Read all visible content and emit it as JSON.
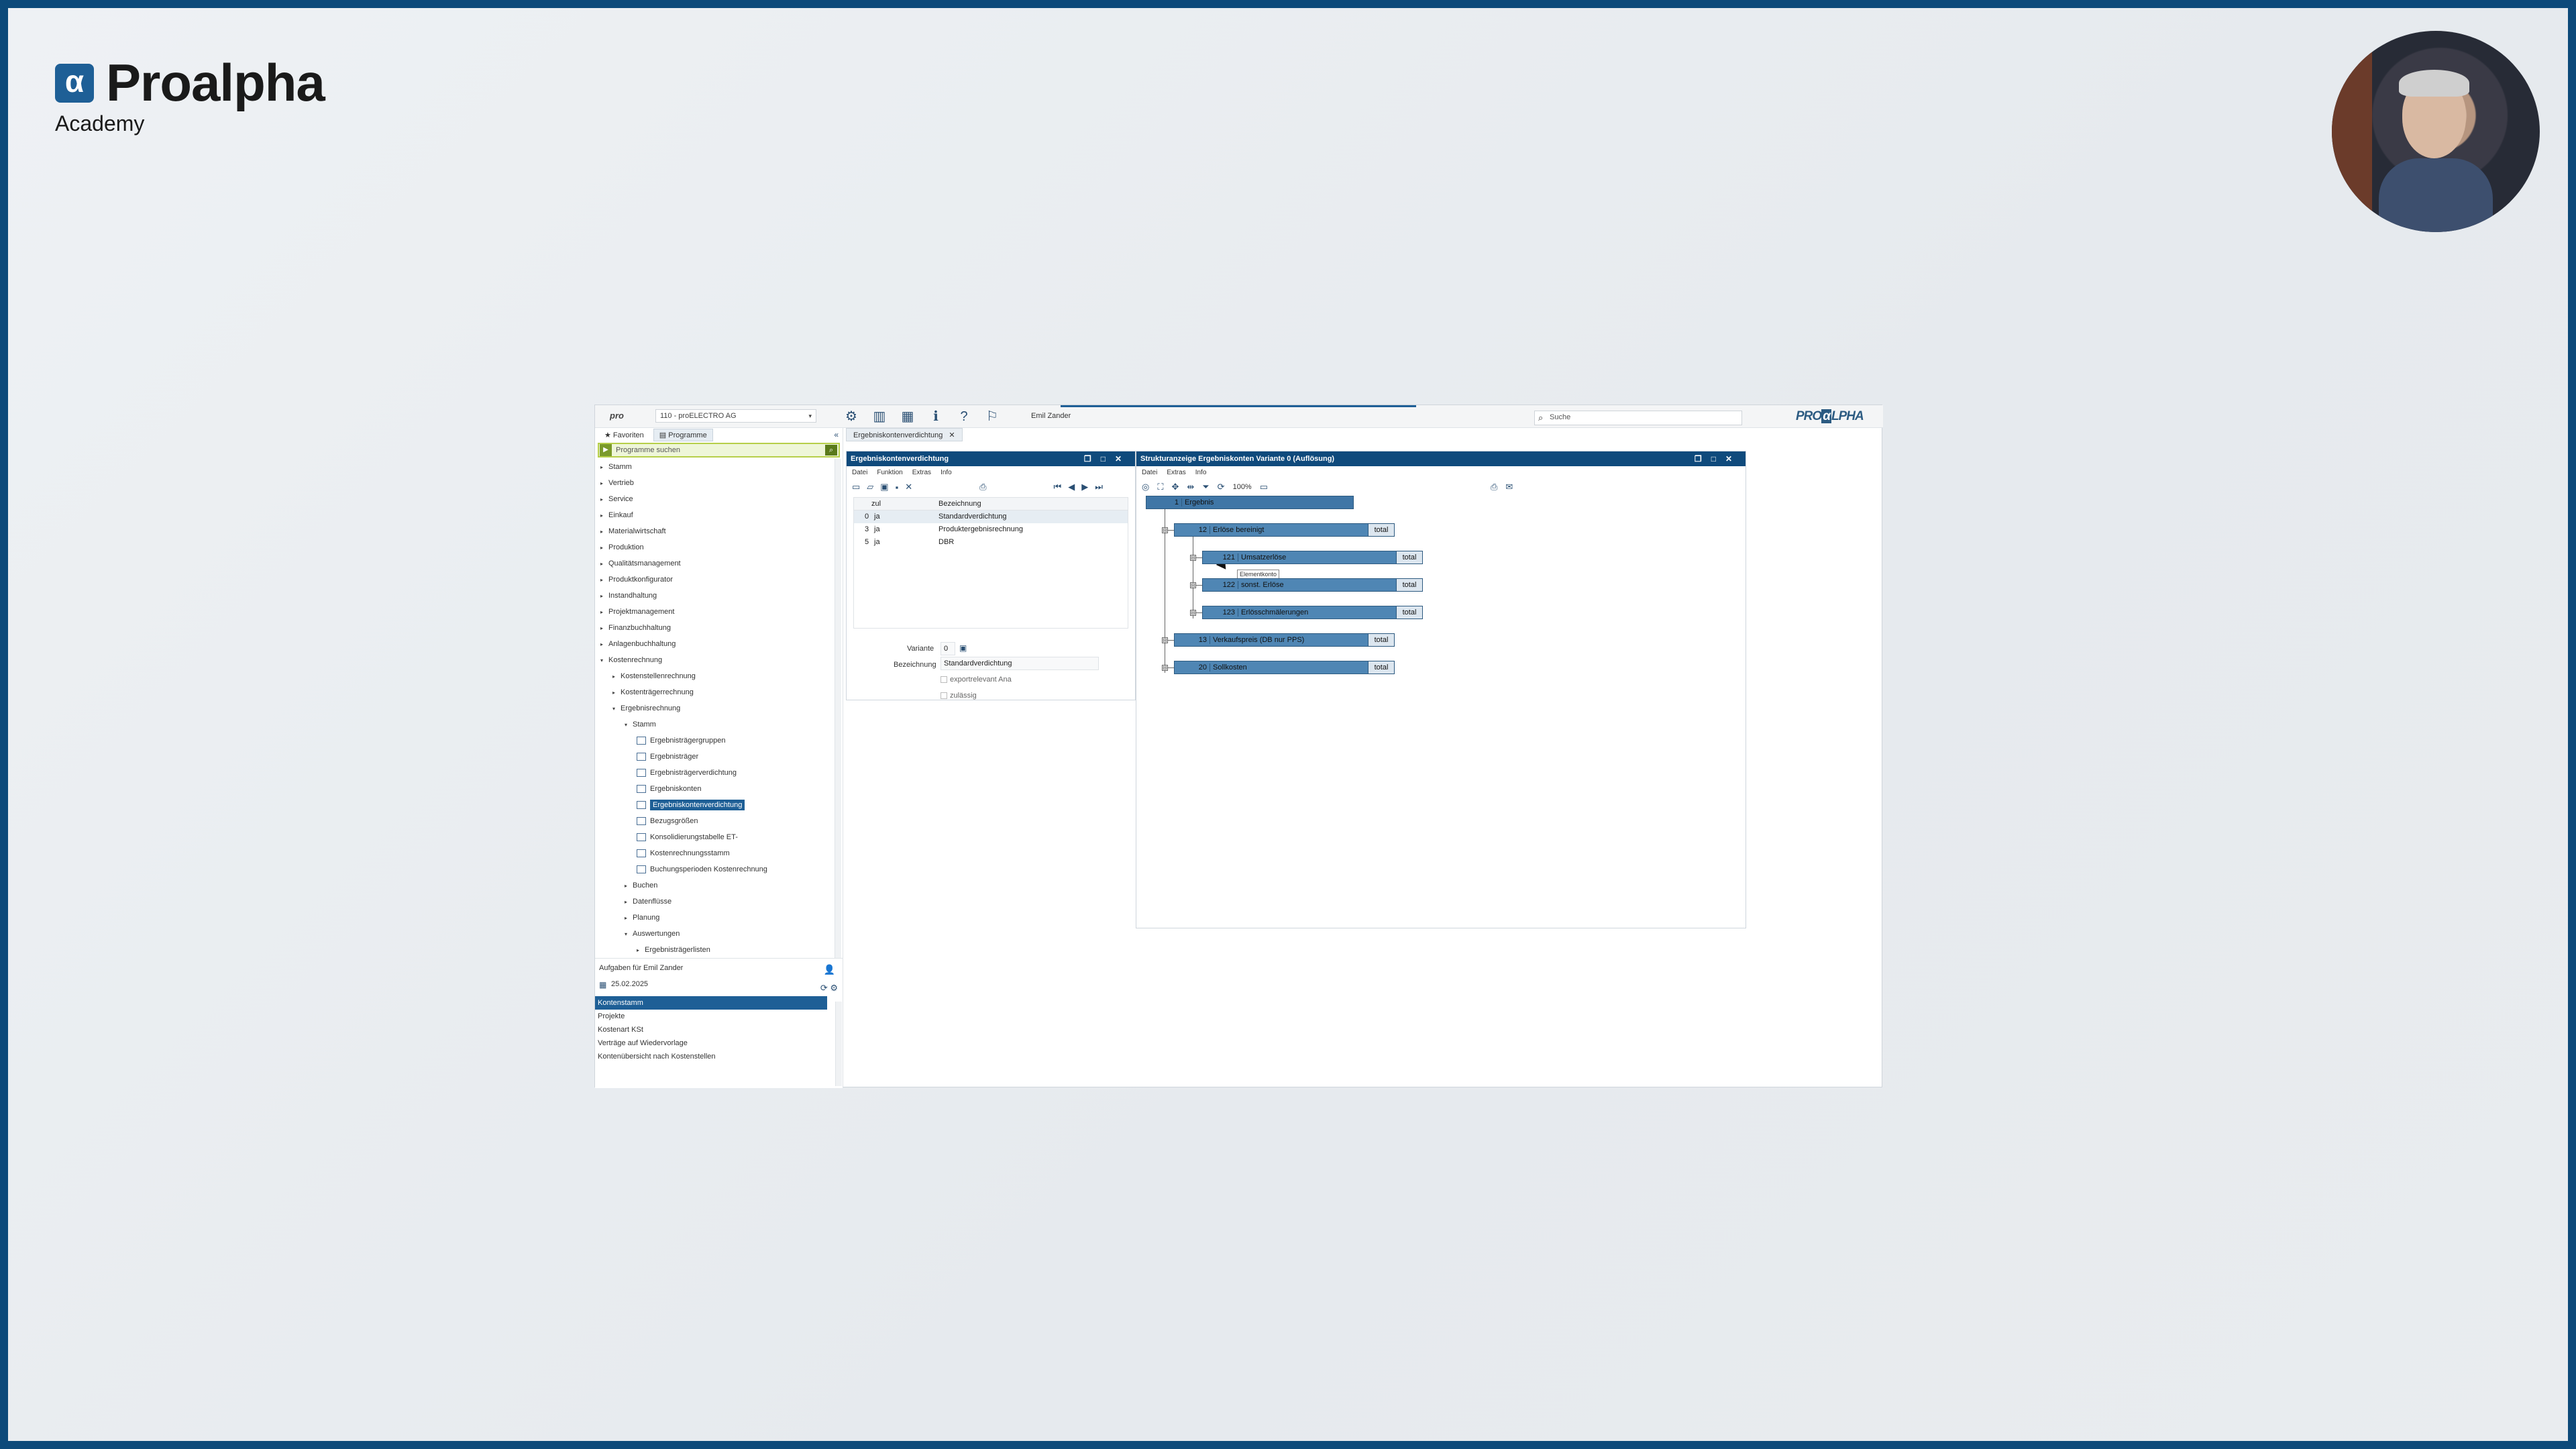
{
  "branding": {
    "logo_mark": "α",
    "logo_text": "Proalpha",
    "academy": "Academy"
  },
  "topbar": {
    "pro_logo": "pro",
    "company": "110 - proELECTRO AG",
    "user": "Emil Zander",
    "search_placeholder": "Suche",
    "brand_pre": "PRO",
    "brand_box": "α",
    "brand_post": "LPHA"
  },
  "left_panel": {
    "tabs": [
      "Favoriten",
      "Programme"
    ],
    "program_search_placeholder": "Programme suchen",
    "tree": [
      {
        "label": "Stamm",
        "level": 0,
        "arrow": "▸"
      },
      {
        "label": "Vertrieb",
        "level": 0,
        "arrow": "▸"
      },
      {
        "label": "Service",
        "level": 0,
        "arrow": "▸"
      },
      {
        "label": "Einkauf",
        "level": 0,
        "arrow": "▸"
      },
      {
        "label": "Materialwirtschaft",
        "level": 0,
        "arrow": "▸"
      },
      {
        "label": "Produktion",
        "level": 0,
        "arrow": "▸"
      },
      {
        "label": "Qualitätsmanagement",
        "level": 0,
        "arrow": "▸"
      },
      {
        "label": "Produktkonfigurator",
        "level": 0,
        "arrow": "▸"
      },
      {
        "label": "Instandhaltung",
        "level": 0,
        "arrow": "▸"
      },
      {
        "label": "Projektmanagement",
        "level": 0,
        "arrow": "▸"
      },
      {
        "label": "Finanzbuchhaltung",
        "level": 0,
        "arrow": "▸"
      },
      {
        "label": "Anlagenbuchhaltung",
        "level": 0,
        "arrow": "▸"
      },
      {
        "label": "Kostenrechnung",
        "level": 0,
        "arrow": "▾"
      },
      {
        "label": "Kostenstellenrechnung",
        "level": 1,
        "arrow": "▸"
      },
      {
        "label": "Kostenträgerrechnung",
        "level": 1,
        "arrow": "▸"
      },
      {
        "label": "Ergebnisrechnung",
        "level": 1,
        "arrow": "▾"
      },
      {
        "label": "Stamm",
        "level": 2,
        "arrow": "▾"
      },
      {
        "label": "Ergebnisträgergruppen",
        "level": 3,
        "doc": true
      },
      {
        "label": "Ergebnisträger",
        "level": 3,
        "doc": true
      },
      {
        "label": "Ergebnisträgerverdichtung",
        "level": 3,
        "doc": true
      },
      {
        "label": "Ergebniskonten",
        "level": 3,
        "doc": true
      },
      {
        "label": "Ergebniskontenverdichtung",
        "level": 3,
        "doc": true,
        "selected": true
      },
      {
        "label": "Bezugsgrößen",
        "level": 3,
        "doc": true
      },
      {
        "label": "Konsolidierungstabelle ET-",
        "level": 3,
        "doc": true
      },
      {
        "label": "Kostenrechnungsstamm",
        "level": 3,
        "doc": true
      },
      {
        "label": "Buchungsperioden Kostenrechnung",
        "level": 3,
        "doc": true
      },
      {
        "label": "Buchen",
        "level": 2,
        "arrow": "▸"
      },
      {
        "label": "Datenflüsse",
        "level": 2,
        "arrow": "▸"
      },
      {
        "label": "Planung",
        "level": 2,
        "arrow": "▸"
      },
      {
        "label": "Auswertungen",
        "level": 2,
        "arrow": "▾"
      },
      {
        "label": "Ergebnisträgerlisten",
        "level": 3,
        "arrow": "▸"
      }
    ],
    "tasks": {
      "title": "Aufgaben für Emil Zander",
      "date": "25.02.2025",
      "items": [
        "Kontenstamm",
        "Projekte",
        "Kostenart KSt",
        "Verträge auf Wiedervorlage",
        "Kontenübersicht nach Kostenstellen"
      ]
    }
  },
  "doc_tab": {
    "label": "Ergebniskontenverdichtung"
  },
  "window1": {
    "title": "Ergebniskontenverdichtung",
    "menu": [
      "Datei",
      "Funktion",
      "Extras",
      "Info"
    ],
    "grid": {
      "headers": [
        "",
        "zul",
        "Bezeichnung"
      ],
      "rows": [
        {
          "nr": "0",
          "zul": "ja",
          "label": "Standardverdichtung",
          "selected": true
        },
        {
          "nr": "3",
          "zul": "ja",
          "label": "Produktergebnisrechnung"
        },
        {
          "nr": "5",
          "zul": "ja",
          "label": "DBR"
        }
      ]
    },
    "form": {
      "variante_label": "Variante",
      "variante_value": "0",
      "bezeichnung_label": "Bezeichnung",
      "bezeichnung_value": "Standardverdichtung",
      "check1": "exportrelevant Ana",
      "check2": "zulässig"
    }
  },
  "window2": {
    "title": "Strukturanzeige Ergebniskonten Variante 0 (Auflösung)",
    "menu": [
      "Datei",
      "Extras",
      "Info"
    ],
    "zoom": "100%",
    "tooltip": "Elementkonto",
    "nodes": [
      {
        "num": "1",
        "label": "Ergebnis",
        "total": ""
      },
      {
        "num": "12",
        "label": "Erlöse bereinigt",
        "total": "total"
      },
      {
        "num": "121",
        "label": "Umsatzerlöse",
        "total": "total"
      },
      {
        "num": "122",
        "label": "sonst. Erlöse",
        "total": "total"
      },
      {
        "num": "123",
        "label": "Erlösschmälerungen",
        "total": "total"
      },
      {
        "num": "13",
        "label": "Verkaufspreis (DB nur PPS)",
        "total": "total"
      },
      {
        "num": "20",
        "label": "Sollkosten",
        "total": "total"
      }
    ]
  }
}
